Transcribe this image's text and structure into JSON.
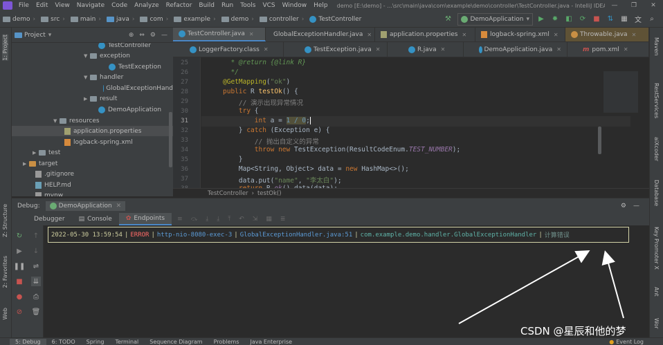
{
  "menubar": {
    "items": [
      "File",
      "Edit",
      "View",
      "Navigate",
      "Code",
      "Analyze",
      "Refactor",
      "Build",
      "Run",
      "Tools",
      "VCS",
      "Window",
      "Help"
    ],
    "title": "demo [E:\\demo] - ...\\src\\main\\java\\com\\example\\demo\\controller\\TestController.java - IntelliJ IDEA"
  },
  "navbar": {
    "crumbs": [
      "demo",
      "src",
      "main",
      "java",
      "com",
      "example",
      "demo",
      "controller",
      "TestController"
    ],
    "run_config": "DemoApplication"
  },
  "left_tools": {
    "project": "1: Project",
    "structure": "Z: Structure",
    "favorites": "2: Favorites",
    "web": "Web"
  },
  "right_tools": {
    "maven": "Maven",
    "rest": "RestServices",
    "aixcoder": "aiXcoder",
    "database": "Database",
    "keypromoter": "Key Promoter X",
    "ant": "Ant",
    "wor": "Wor"
  },
  "project": {
    "header": "Project",
    "tree": [
      {
        "label": "TestController",
        "icon": "class",
        "expand": ""
      },
      {
        "label": "exception",
        "icon": "package",
        "expand": "▼"
      },
      {
        "label": "TestException",
        "icon": "class",
        "expand": ""
      },
      {
        "label": "handler",
        "icon": "package",
        "expand": "▼"
      },
      {
        "label": "GlobalExceptionHand",
        "icon": "class",
        "expand": ""
      },
      {
        "label": "result",
        "icon": "package",
        "expand": "▶"
      },
      {
        "label": "DemoApplication",
        "icon": "class",
        "expand": ""
      },
      {
        "label": "resources",
        "icon": "package",
        "expand": "▼"
      },
      {
        "label": "application.properties",
        "icon": "properties",
        "expand": ""
      },
      {
        "label": "logback-spring.xml",
        "icon": "xml",
        "expand": ""
      },
      {
        "label": "test",
        "icon": "package",
        "expand": "▶"
      },
      {
        "label": "target",
        "icon": "package-orange",
        "expand": "▶"
      },
      {
        "label": ".gitignore",
        "icon": "file",
        "expand": ""
      },
      {
        "label": "HELP.md",
        "icon": "file",
        "expand": ""
      },
      {
        "label": "mvnw",
        "icon": "file",
        "expand": ""
      }
    ]
  },
  "editor_tabs_row1": [
    "TestController.java",
    "GlobalExceptionHandler.java",
    "application.properties",
    "logback-spring.xml",
    "Throwable.java"
  ],
  "editor_tabs_row2": [
    "LoggerFactory.class",
    "TestException.java",
    "R.java",
    "DemoApplication.java",
    "pom.xml"
  ],
  "code": {
    "line_numbers": [
      "25",
      "26",
      "27",
      "28",
      "29",
      "30",
      "31",
      "32",
      "33",
      "34",
      "35",
      "36",
      "37",
      "38"
    ],
    "current_line": "31"
  },
  "editor_breadcrumb": [
    "TestController",
    "testOk()"
  ],
  "debug": {
    "label": "Debug:",
    "session": "DemoApplication",
    "tabs": [
      "Debugger",
      "Console",
      "Endpoints"
    ]
  },
  "log": {
    "timestamp": "2022-05-30 13:59:54",
    "level": "ERROR",
    "thread": "http-nio-8080-exec-3",
    "location": "GlobalExceptionHandler.java:51",
    "logger": "com.example.demo.handler.GlobalExceptionHandler",
    "message": "计算错误"
  },
  "statusbar": {
    "items": [
      "5: Debug",
      "6: TODO",
      "Spring",
      "Terminal",
      "Sequence Diagram",
      "Problems",
      "Java Enterprise"
    ],
    "event_log": "Event Log"
  },
  "watermark": "CSDN @星辰和他的梦"
}
